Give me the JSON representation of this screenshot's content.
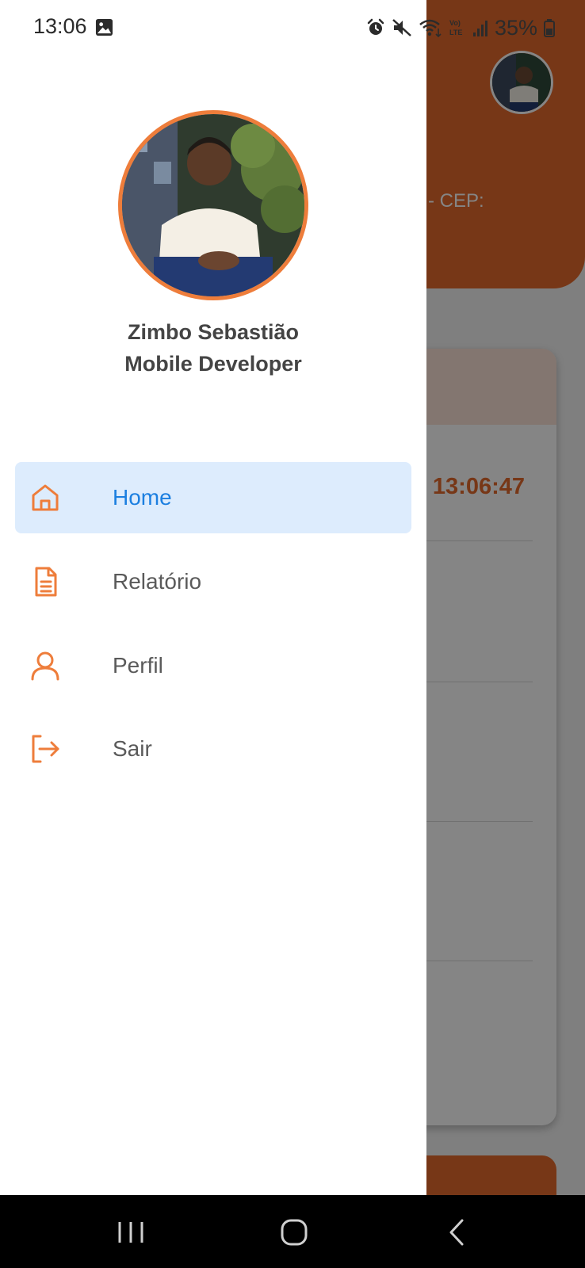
{
  "status_bar": {
    "time": "13:06",
    "battery": "35%",
    "icons": [
      "gallery-icon",
      "alarm-icon",
      "mute-icon",
      "wifi-icon",
      "volte-icon",
      "signal-icon",
      "battery-icon"
    ]
  },
  "background": {
    "address_fragment": "o - CEP:",
    "clock": "13:06:47"
  },
  "profile": {
    "name": "Zimbo Sebastião",
    "role": "Mobile Developer"
  },
  "menu": {
    "items": [
      {
        "label": "Home",
        "icon": "home-icon",
        "active": true
      },
      {
        "label": "Relatório",
        "icon": "document-icon",
        "active": false
      },
      {
        "label": "Perfil",
        "icon": "user-icon",
        "active": false
      },
      {
        "label": "Sair",
        "icon": "logout-icon",
        "active": false
      }
    ]
  },
  "nav_bar": {
    "buttons": [
      "recents-icon",
      "home-circle-icon",
      "back-icon"
    ]
  },
  "colors": {
    "accent": "#ee7d3b",
    "active_bg": "#ddecfd",
    "active_text": "#1c7fe0",
    "header": "#e46a2c"
  }
}
